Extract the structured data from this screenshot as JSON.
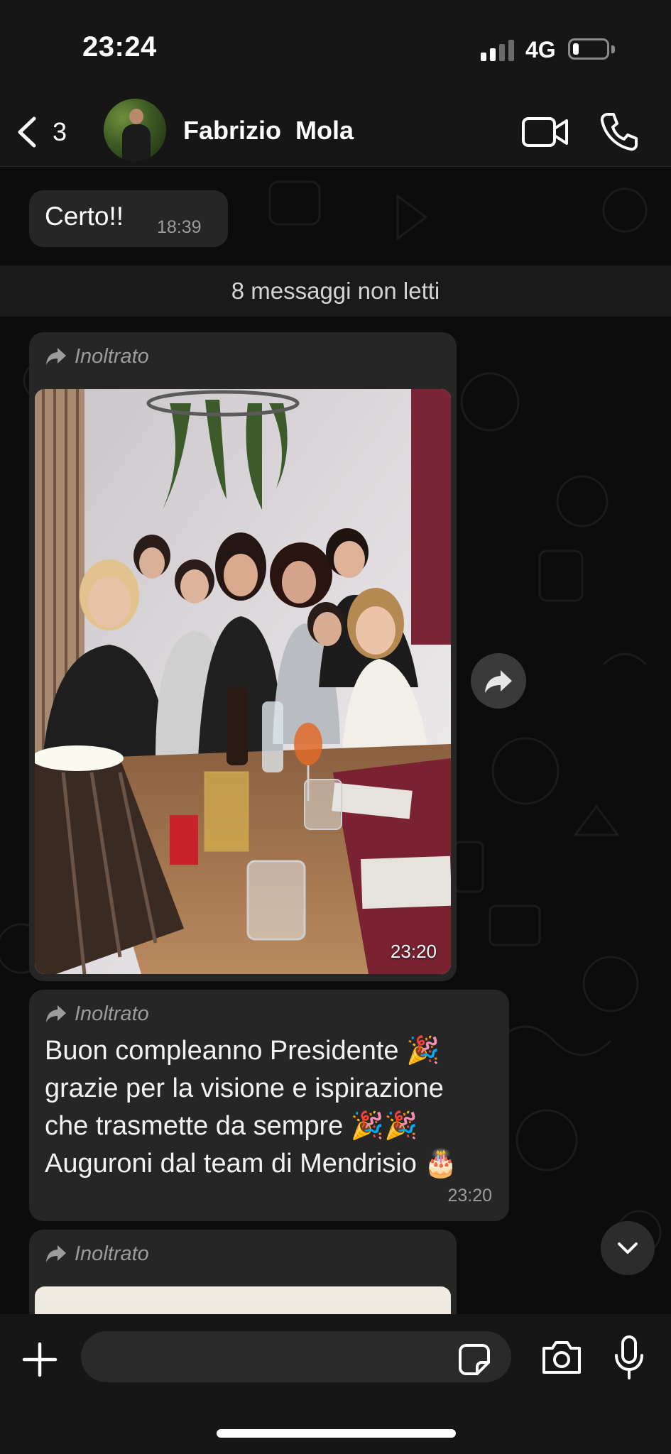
{
  "status_bar": {
    "time": "23:24",
    "network": "4G",
    "signal_bars_active": 2,
    "signal_bars_total": 4,
    "battery_level": 0.12
  },
  "header": {
    "back_count": "3",
    "contact_name": "Fabrizio  Mola",
    "icons": [
      "chevron-left-icon",
      "video-camera-icon",
      "phone-icon"
    ]
  },
  "messages": [
    {
      "id": "m1",
      "text": "Certo!!",
      "time": "18:39"
    },
    {
      "id": "unread",
      "text": "8 messaggi non letti"
    },
    {
      "id": "m2",
      "forwarded_label": "Inoltrato",
      "type": "photo",
      "time": "23:20"
    },
    {
      "id": "m3",
      "forwarded_label": "Inoltrato",
      "lines": [
        "Buon compleanno Presidente 🎉",
        "grazie per la visione e ispirazione",
        "che trasmette da sempre 🎉🎉",
        "Auguroni dal team di Mendrisio 🎂"
      ],
      "time": "23:20"
    },
    {
      "id": "m4",
      "forwarded_label": "Inoltrato",
      "type": "photo"
    }
  ],
  "input_bar": {
    "placeholder": "",
    "icons": [
      "plus-icon",
      "sticker-icon",
      "camera-icon",
      "microphone-icon"
    ]
  },
  "colors": {
    "background": "#0c0c0c",
    "bar": "#161616",
    "bubble": "#262626",
    "secondary_text": "#9c9c9c"
  }
}
